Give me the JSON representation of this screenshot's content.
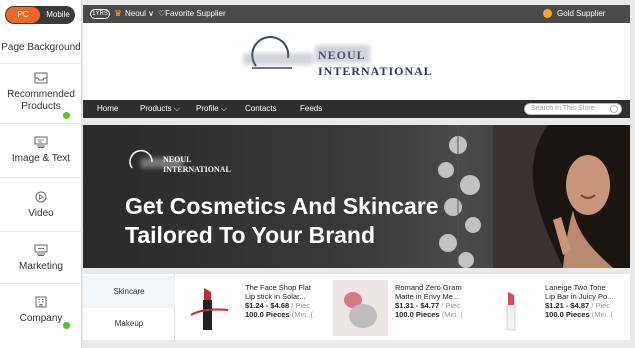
{
  "sidebar": {
    "toggle": {
      "pc": "PC",
      "mobile": "Mobile"
    },
    "items": [
      {
        "label": "Page Background",
        "icon": "page-background-icon",
        "dot": false
      },
      {
        "label": "Recommended Products",
        "line1": "Recommended",
        "line2": "Products",
        "icon": "inbox-icon",
        "dot": true
      },
      {
        "label": "Image & Text",
        "icon": "image-text-icon",
        "dot": false
      },
      {
        "label": "Video",
        "icon": "video-play-icon",
        "dot": false
      },
      {
        "label": "Marketing",
        "icon": "marketing-icon",
        "dot": false
      },
      {
        "label": "Company",
        "icon": "company-icon",
        "dot": true
      }
    ],
    "dot_color": "#52c41a"
  },
  "topbar": {
    "years_badge": "1YRS",
    "company": "Neoul",
    "favorite": "Favorite Supplier",
    "gold": "Gold Supplier"
  },
  "logo": {
    "line1": "NEOUL",
    "line2": "INTERNATIONAL"
  },
  "nav": {
    "items": [
      "Home",
      "Products",
      "Profile",
      "Contacts",
      "Feeds"
    ],
    "search_placeholder": "Search In This Store"
  },
  "banner": {
    "logo_line1": "NEOUL",
    "logo_line2": "INTERNATIONAL",
    "headline_line1": "Get Cosmetics And Skincare",
    "headline_line2": "Tailored To Your Brand"
  },
  "categories": [
    "Skincare",
    "Makeup"
  ],
  "products": [
    {
      "title1": "The Face Shop Flat",
      "title2": "Lip stick in Solar...",
      "price": "$1.24 - $4.68",
      "price_unit": "/ Piec",
      "moq": "100.0 Pieces",
      "moq_note": "(Min. (",
      "image_icon": "lipstick-image"
    },
    {
      "title1": "Romand Zero Gram",
      "title2": "Matte in Envy Me...",
      "price": "$1.31 - $4.77",
      "price_unit": "/ Piec",
      "moq": "100.0 Pieces",
      "moq_note": "(Min. (",
      "image_icon": "lip-tint-image"
    },
    {
      "title1": "Laneige Two Tone",
      "title2": "Lip Bar in Juicy Po...",
      "price": "$1.21 - $4.87",
      "price_unit": "/ Piec",
      "moq": "100.0 Pieces",
      "moq_note": "(Min. (",
      "image_icon": "lip-bar-image"
    }
  ],
  "colors": {
    "accent": "#f26522",
    "topbar": "#4a4a4a",
    "nav": "#2f2f2f",
    "gold": "#f5a623",
    "logo_text": "#2b3a55"
  }
}
